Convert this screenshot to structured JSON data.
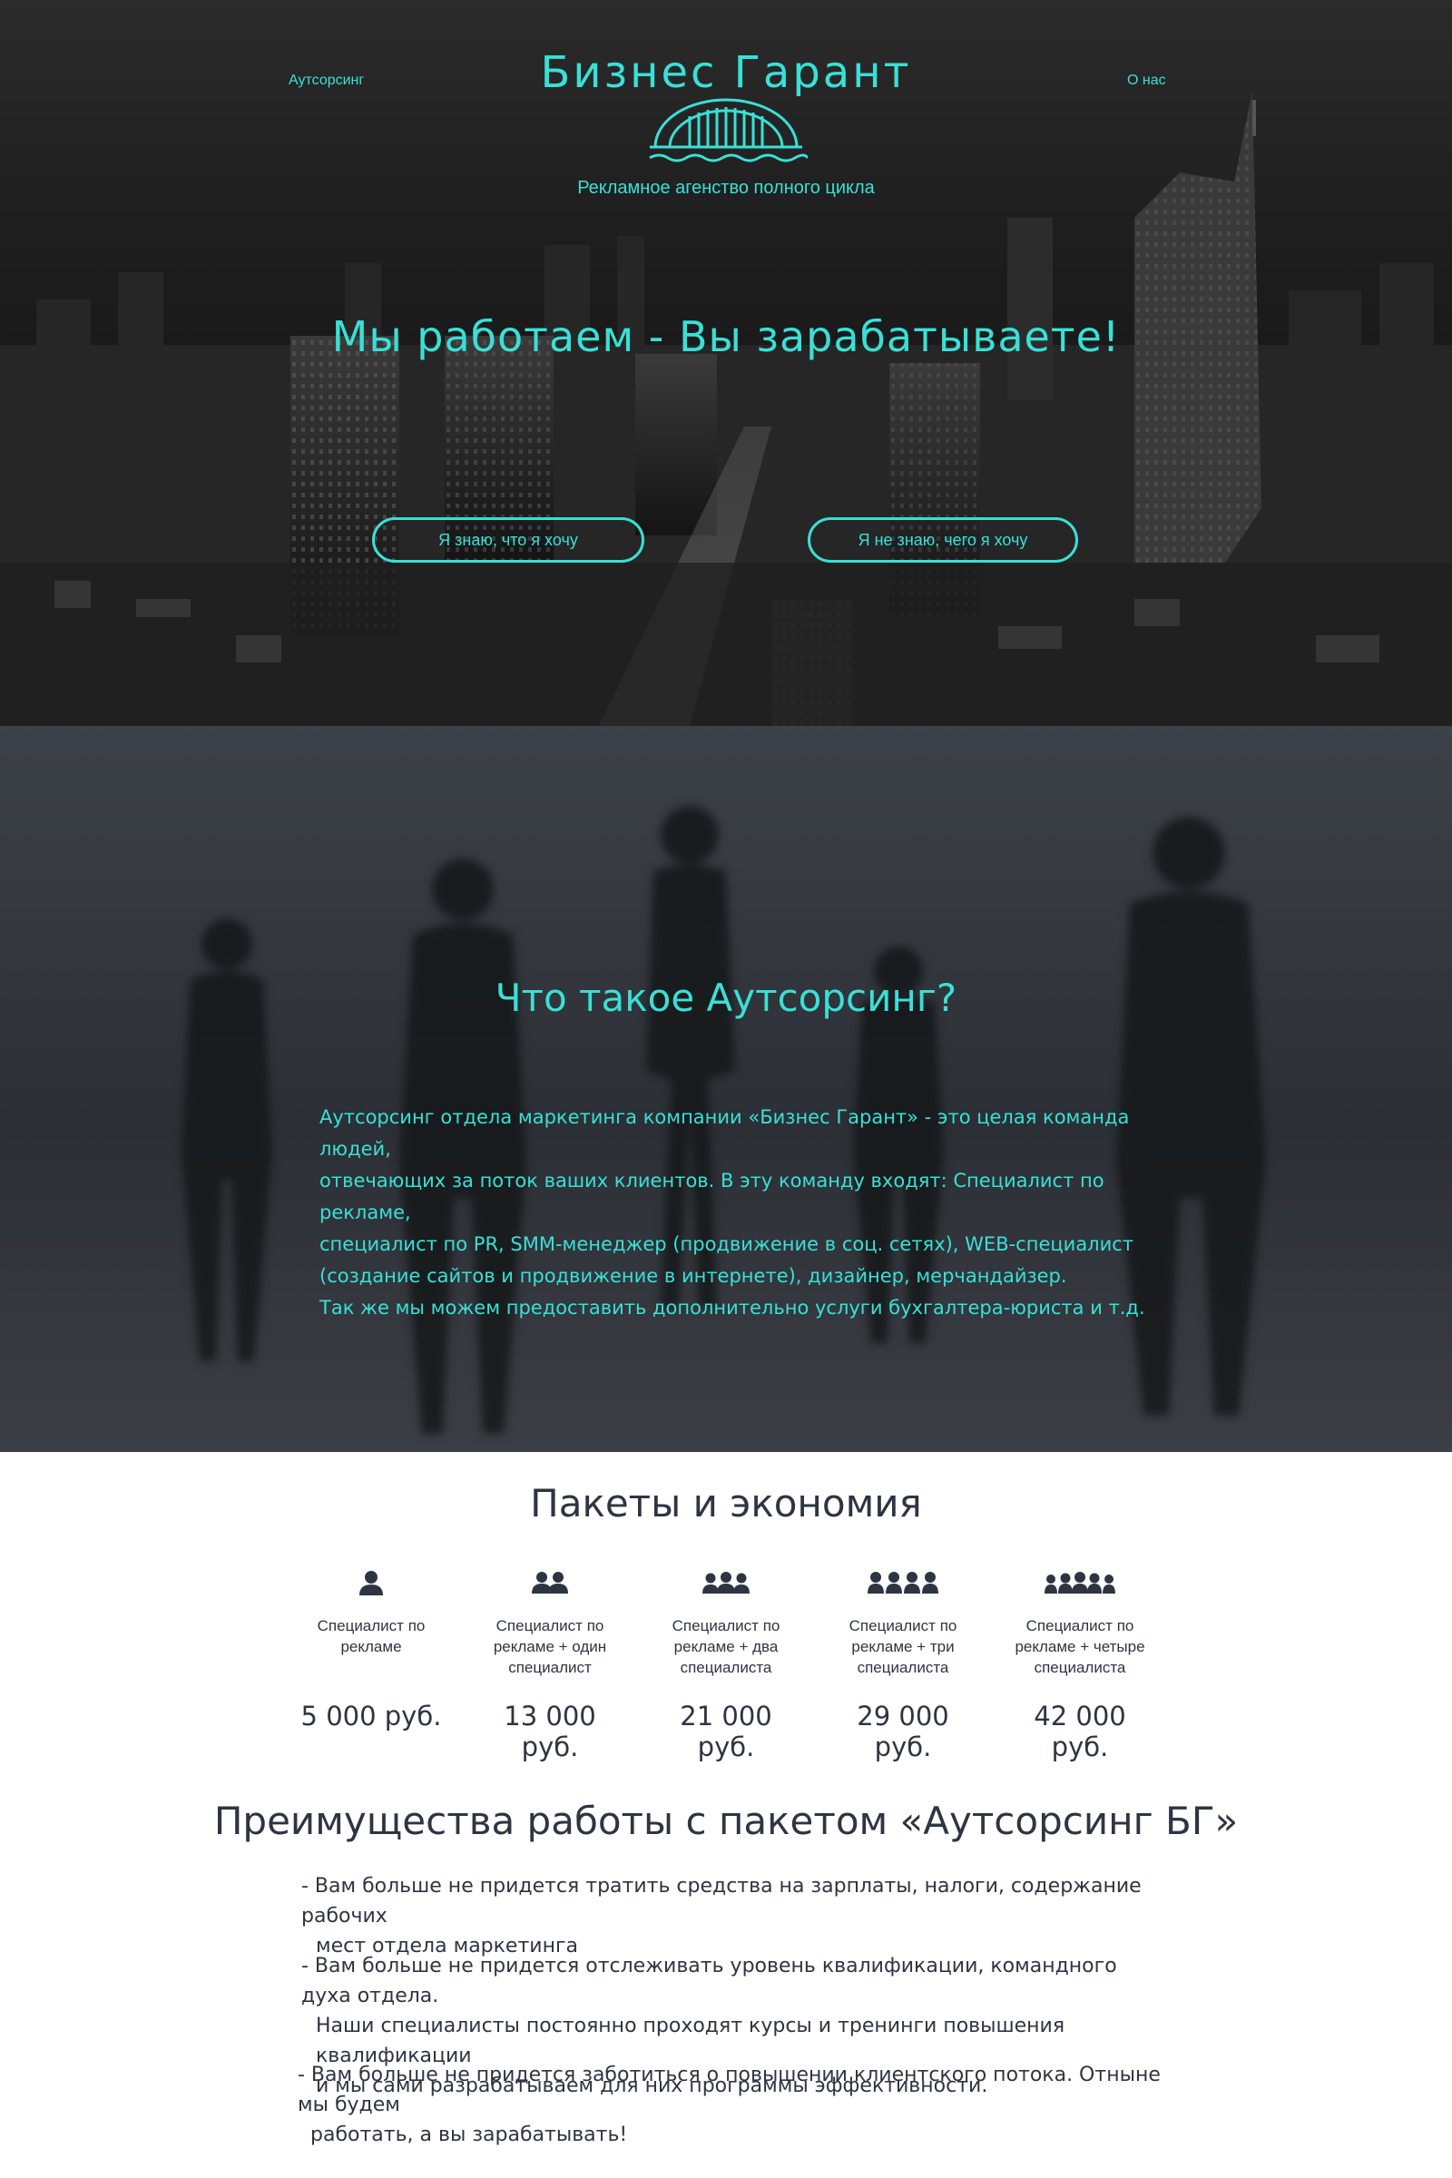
{
  "header": {
    "nav_left": "Аутсорсинг",
    "nav_right": "О нас",
    "brand_title": "Бизнес Гарант",
    "brand_tagline": "Рекламное агенство полного цикла",
    "logo_icon": "bridge-logo-icon"
  },
  "hero": {
    "headline": "Мы работаем - Вы зарабатываете!",
    "button_know": "Я знаю, что я хочу",
    "button_dont_know": "Я не знаю, чего я хочу"
  },
  "outsourcing": {
    "heading": "Что такое Аутсорсинг?",
    "lines": [
      "Аутсорсинг отдела маркетинга компании «Бизнес Гарант» - это целая команда людей,",
      "отвечающих за поток ваших клиентов. В эту команду входят: Специалист по рекламе,",
      "специалист по PR, SMM-менеджер (продвижение в соц. сетях), WEB-специалист",
      "(создание сайтов и продвижение в интернете), дизайнер, мерчандайзер.",
      "Так же мы можем предоставить дополнительно услуги бухгалтера-юриста и т.д."
    ]
  },
  "packages": {
    "heading": "Пакеты и экономия",
    "items": [
      {
        "icon": "single-user-icon",
        "desc": [
          "Специалист по",
          "рекламе"
        ],
        "price": "5 000 руб."
      },
      {
        "icon": "two-users-icon",
        "desc": [
          "Специалист по",
          "рекламе + один",
          "специалист"
        ],
        "price": "13 000 руб."
      },
      {
        "icon": "three-users-icon",
        "desc": [
          "Специалист по",
          "рекламе + два",
          "специалиста"
        ],
        "price": "21 000 руб."
      },
      {
        "icon": "four-users-icon",
        "desc": [
          "Специалист по",
          "рекламе + три",
          "специалиста"
        ],
        "price": "29 000 руб."
      },
      {
        "icon": "five-users-icon",
        "desc": [
          "Специалист по",
          "рекламе + четыре",
          "специалиста"
        ],
        "price": "42 000 руб."
      }
    ]
  },
  "advantages": {
    "heading": "Преимущества работы с пакетом «Аутсорсинг БГ»",
    "items": [
      [
        "- Вам больше не придется тратить средства на зарплаты, налоги, содержание рабочих",
        "мест отдела маркетинга"
      ],
      [
        "- Вам больше не придется отслеживать уровень квалификации, командного духа отдела.",
        "Наши специалисты постоянно проходят курсы и тренинги повышения квалификации",
        "и мы сами разрабатываем для них программы эффективности."
      ],
      [
        "- Вам больше не придется заботиться о повышении клиентского потока. Отныне мы будем",
        "работать, а вы зарабатывать!"
      ]
    ]
  },
  "colors": {
    "accent": "#39e0d6",
    "dark_text": "#2e3542",
    "hero_bg": "#1d1d1d",
    "section_bg": "#2c2f35"
  }
}
